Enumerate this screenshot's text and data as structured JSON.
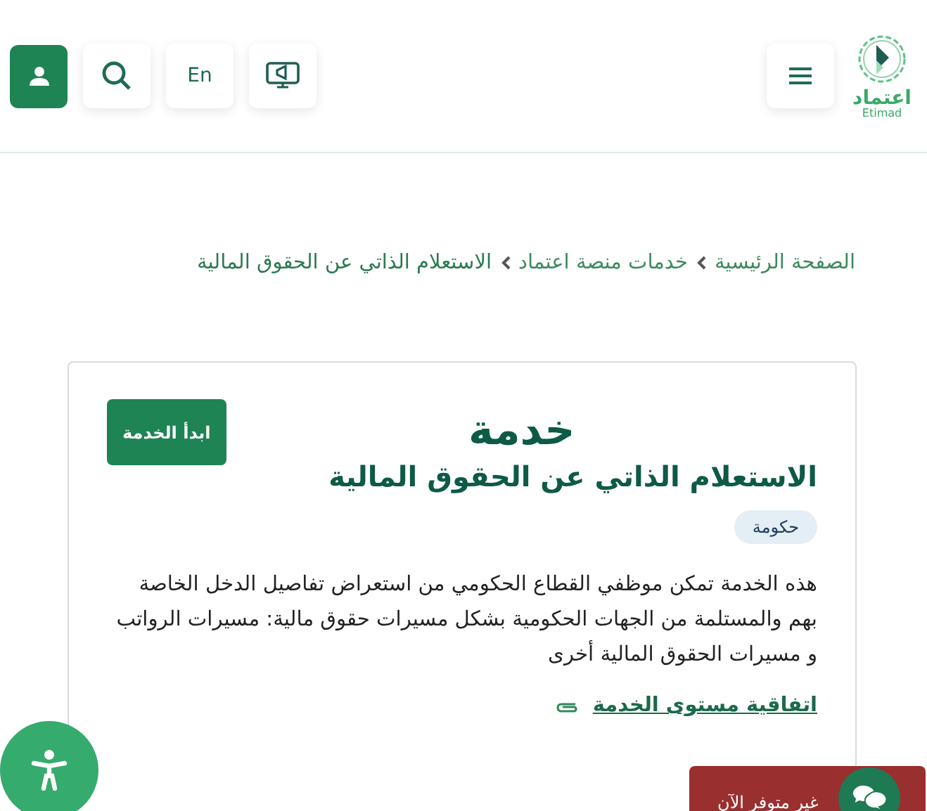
{
  "header": {
    "logo": {
      "arabic": "اعتماد",
      "latin": "Etimad"
    },
    "language_button": "En"
  },
  "breadcrumb": [
    {
      "label": "الصفحة الرئيسية",
      "current": false
    },
    {
      "label": "خدمات منصة اعتماد",
      "current": false
    },
    {
      "label": "الاستعلام الذاتي عن الحقوق المالية",
      "current": true
    }
  ],
  "service": {
    "heading": "خدمة",
    "title": "الاستعلام الذاتي عن الحقوق المالية",
    "tag": "حكومة",
    "start_button": "ابدأ الخدمة",
    "description": "هذه الخدمة تمكن موظفي القطاع الحكومي من استعراض تفاصيل الدخل الخاصة بهم والمستلمة من الجهات الحكومية بشكل مسيرات حقوق مالية: مسيرات الرواتب و مسيرات الحقوق المالية أخرى",
    "attachment_link": "اتفاقية مستوى الخدمة"
  },
  "chat": {
    "status": "غير متوفر الآن"
  }
}
